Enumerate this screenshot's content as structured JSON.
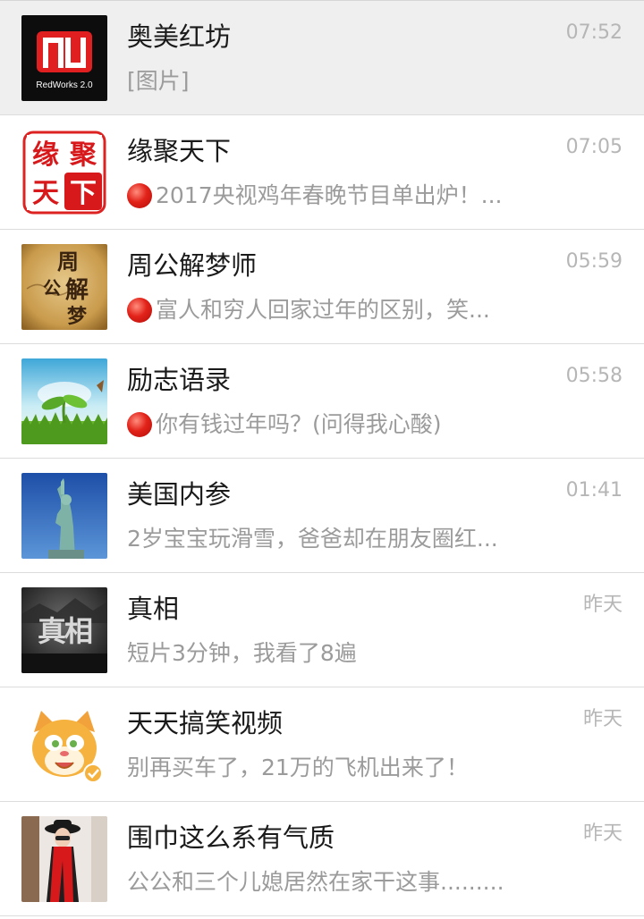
{
  "chats": [
    {
      "name": "奥美红坊",
      "time": "07:52",
      "preview": "[图片]",
      "pinned": true,
      "has_dot": false,
      "avatar": "redworks-logo",
      "avatar_text": "RedWorks 2.0"
    },
    {
      "name": "缘聚天下",
      "time": "07:05",
      "preview": "2017央视鸡年春晚节目单出炉！...",
      "pinned": false,
      "has_dot": true,
      "avatar": "yuanju-logo",
      "avatar_text": [
        "缘",
        "聚",
        "天",
        "下"
      ]
    },
    {
      "name": "周公解梦师",
      "time": "05:59",
      "preview": "富人和穷人回家过年的区别，笑...",
      "pinned": false,
      "has_dot": true,
      "avatar": "zhougong-calligraphy",
      "avatar_text": [
        "周",
        "公",
        "解",
        "梦"
      ]
    },
    {
      "name": "励志语录",
      "time": "05:58",
      "preview": "你有钱过年吗？(问得我心酸)",
      "pinned": false,
      "has_dot": true,
      "avatar": "sprout-image"
    },
    {
      "name": "美国内参",
      "time": "01:41",
      "preview": "2岁宝宝玩滑雪，爸爸却在朋友圈红...",
      "pinned": false,
      "has_dot": false,
      "avatar": "statue-of-liberty-image"
    },
    {
      "name": "真相",
      "time": "昨天",
      "preview": "短片3分钟，我看了8遍",
      "pinned": false,
      "has_dot": false,
      "avatar": "zhenxiang-logo",
      "avatar_text": "真相"
    },
    {
      "name": "天天搞笑视频",
      "time": "昨天",
      "preview": "别再买车了，21万的飞机出来了！",
      "pinned": false,
      "has_dot": false,
      "avatar": "cartoon-cat-image"
    },
    {
      "name": "围巾这么系有气质",
      "time": "昨天",
      "preview": "公公和三个儿媳居然在家干这事.........",
      "pinned": false,
      "has_dot": false,
      "avatar": "woman-red-scarf-image"
    }
  ],
  "colors": {
    "dot": "#e2231a",
    "pinned_bg": "#efefef",
    "brand_red": "#e02020"
  }
}
